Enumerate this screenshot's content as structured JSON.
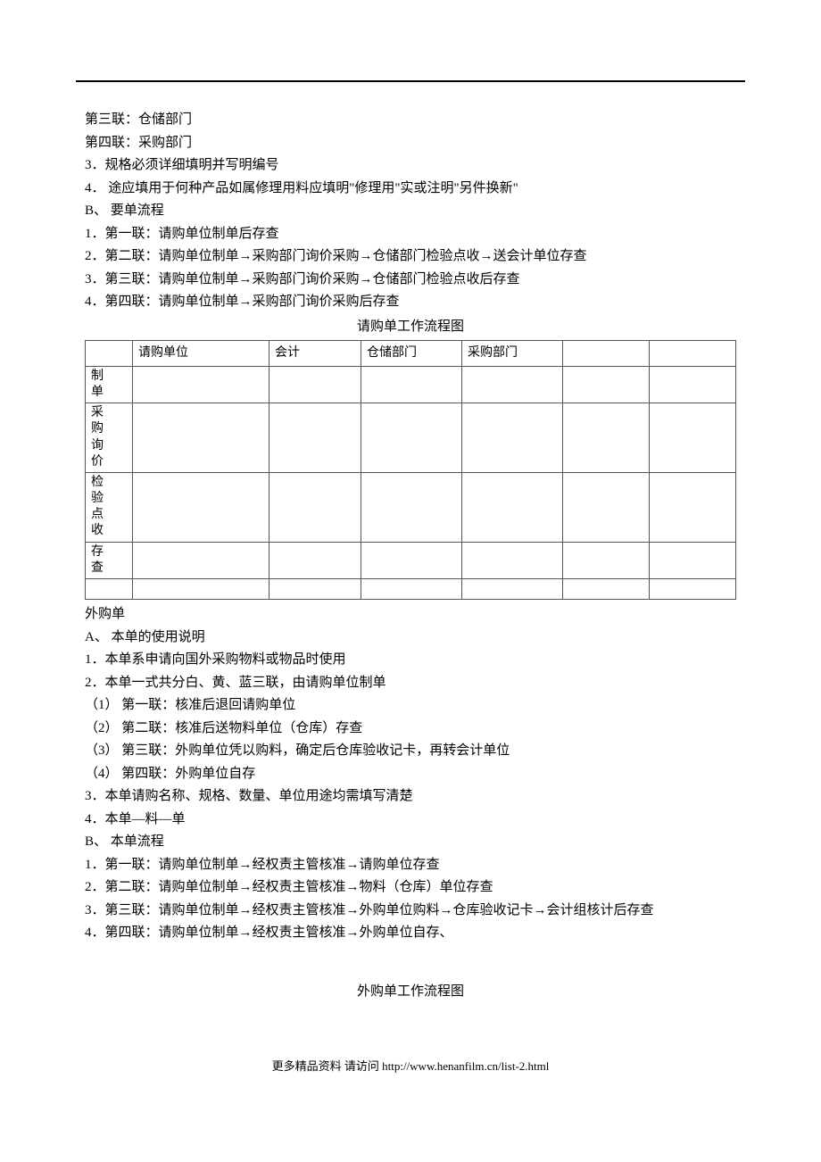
{
  "top_lines": [
    "第三联：仓储部门",
    "第四联：采购部门",
    "3．规格必须详细填明并写明编号",
    "4． 途应填用于何种产品如属修理用料应填明\"修理用\"实或注明\"另件换新\"",
    "B、 要单流程",
    "1．第一联：请购单位制单后存查",
    "2．第二联：请购单位制单→采购部门询价采购→仓储部门检验点收→送会计单位存查",
    "3．第三联：请购单位制单→采购部门询价采购→仓储部门检验点收后存查",
    "4．第四联：请购单位制单→采购部门询价采购后存查"
  ],
  "table1_title": "请购单工作流程图",
  "table1": {
    "headers": [
      "",
      "请购单位",
      "会计",
      "仓储部门",
      "采购部门",
      "",
      ""
    ],
    "rows": [
      [
        "制单",
        "",
        "",
        "",
        "",
        "",
        ""
      ],
      [
        "采购询价",
        "",
        "",
        "",
        "",
        "",
        ""
      ],
      [
        "检验点收",
        "",
        "",
        "",
        "",
        "",
        ""
      ],
      [
        "存查",
        "",
        "",
        "",
        "",
        "",
        ""
      ],
      [
        "",
        "",
        "",
        "",
        "",
        "",
        ""
      ]
    ]
  },
  "mid_lines": [
    "外购单",
    "A、 本单的使用说明",
    "1．本单系申请向国外采购物料或物品时使用",
    "2．本单一式共分白、黄、蓝三联，由请购单位制单",
    "（1） 第一联：核准后退回请购单位",
    "（2） 第二联：核准后送物料单位（仓库）存查",
    "（3） 第三联：外购单位凭以购料，确定后仓库验收记卡，再转会计单位",
    "（4） 第四联：外购单位自存",
    "3．本单请购名称、规格、数量、单位用途均需填写清楚",
    "4．本单—料—单",
    "B、 本单流程",
    "1．第一联：请购单位制单→经权责主管核准→请购单位存查",
    "2．第二联：请购单位制单→经权责主管核准→物料（仓库）单位存查",
    "3．第三联：请购单位制单→经权责主管核准→外购单位购料→仓库验收记卡→会计组核计后存查",
    "4．第四联：请购单位制单→经权责主管核准→外购单位自存、"
  ],
  "table2_title": "外购单工作流程图",
  "footer": "更多精品资料  请访问 http://www.henanfilm.cn/list-2.html"
}
